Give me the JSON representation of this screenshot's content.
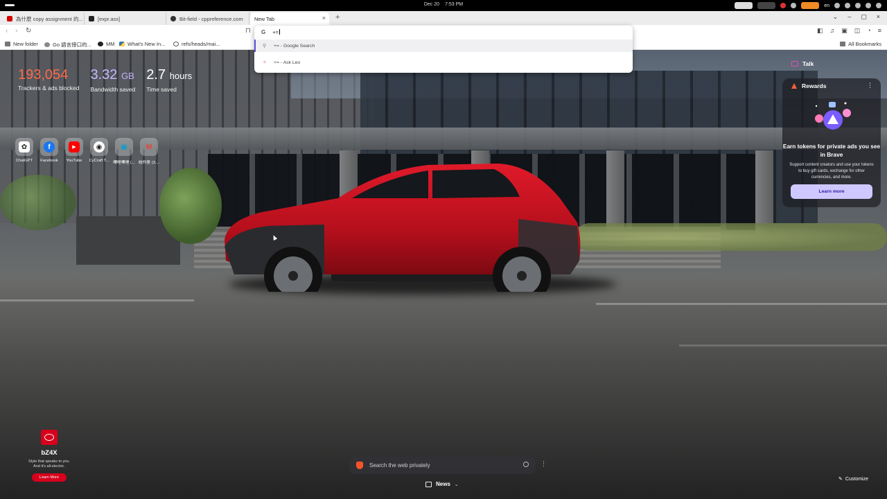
{
  "system": {
    "date": "Dec 20",
    "time": "7:53 PM",
    "language": "en"
  },
  "tabs": [
    {
      "title": "為什麼 copy assignment 的...",
      "icon_color": "#d40000"
    },
    {
      "title": "[expr.ass]",
      "icon_color": "#222222"
    },
    {
      "title": "Bit-field - cppreference.com",
      "icon_color": "#333333"
    },
    {
      "title": "New Tab",
      "icon_color": ""
    }
  ],
  "bookmarks": [
    {
      "label": "New folder",
      "icon": "folder-icon"
    },
    {
      "label": "Go 語言接口的...",
      "icon": "bookmark-icon"
    },
    {
      "label": "MM",
      "icon": "m-icon"
    },
    {
      "label": "What's New In...",
      "icon": "python-icon"
    },
    {
      "label": "refs/heads/mai...",
      "icon": "globe-icon"
    }
  ],
  "all_bookmarks_label": "All Bookmarks",
  "omnibox": {
    "engine_badge": "G",
    "query": "+=",
    "suggestions": [
      {
        "text": "+= - Google Search",
        "icon": "search-icon"
      },
      {
        "text": "+= - Ask Leo",
        "icon": "leo-icon"
      }
    ]
  },
  "stats": {
    "trackers": {
      "value": "193,054",
      "label": "Trackers & ads blocked"
    },
    "bandwidth": {
      "value": "3.32",
      "unit": "GB",
      "label": "Bandwidth saved"
    },
    "time": {
      "value": "2.7",
      "unit": "hours",
      "label": "Time saved"
    }
  },
  "top_sites": [
    {
      "label": "ChatGPT",
      "color": "#ffffff",
      "glyph": "✿",
      "fg": "#222"
    },
    {
      "label": "Facebook",
      "color": "#1877f2",
      "glyph": "f",
      "fg": "#fff"
    },
    {
      "label": "YouTube",
      "color": "#ff0000",
      "glyph": "▶",
      "fg": "#fff"
    },
    {
      "label": "CyCraft T...",
      "color": "#ffffff",
      "glyph": "◉",
      "fg": "#222"
    },
    {
      "label": "嗶哩嗶哩 (...",
      "color": "#00a1d6",
      "glyph": "▣",
      "fg": "#fff"
    },
    {
      "label": "收件匣 (3,...",
      "color": "#ffffff",
      "glyph": "M",
      "fg": "#ea4335"
    }
  ],
  "talk": {
    "label": "Talk"
  },
  "rewards": {
    "title": "Rewards",
    "heading": "Earn tokens for private ads you see in Brave",
    "body": "Support content creators and use your tokens to buy gift cards, exchange for other currencies, and more.",
    "button": "Learn more"
  },
  "ad": {
    "model": "bZ4X",
    "tagline_line1": "Style that speaks to you.",
    "tagline_line2": "And it's all-electric.",
    "button": "Learn More"
  },
  "search": {
    "placeholder": "Search the web privately"
  },
  "news": {
    "label": "News"
  },
  "customize": {
    "label": "Customize"
  },
  "colors": {
    "trackers": "#ff6a4a",
    "bandwidth": "#c6b6ff",
    "brave_orange": "#fb542b",
    "toyota_red": "#d6001c",
    "car_red": "#c8101e"
  }
}
